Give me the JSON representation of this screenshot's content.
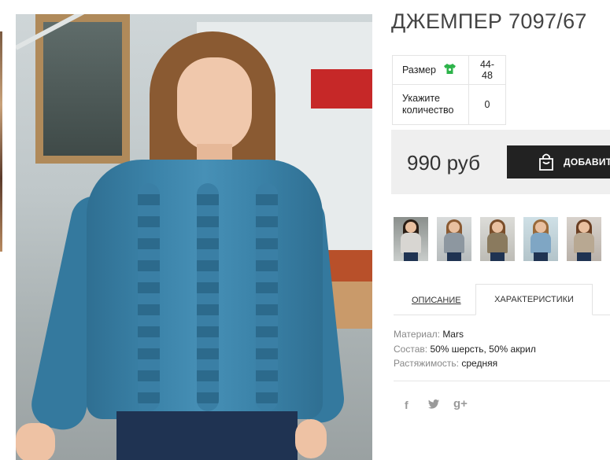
{
  "product": {
    "title": "ДЖЕМПЕР 7097/67",
    "size_label": "Размер",
    "size_value": "44-48",
    "quantity_label": "Укажите количество",
    "quantity_value": "0",
    "price": "990 руб",
    "add_button_label": "ДОБАВИТЬ"
  },
  "icons": {
    "size_icon": "tshirt-icon",
    "size_icon_color": "#2db34a",
    "cart_icon": "shopping-bag-icon",
    "social": [
      "facebook-icon",
      "twitter-icon",
      "google-plus-icon"
    ]
  },
  "social_labels": {
    "facebook": "f",
    "twitter": "🐦",
    "google_plus": "g+"
  },
  "thumbnails": [
    {
      "sweater_color": "#d8d6d2"
    },
    {
      "sweater_color": "#8d97a0"
    },
    {
      "sweater_color": "#8a7a5e"
    },
    {
      "sweater_color": "#7fa6c4"
    },
    {
      "sweater_color": "#b8a892"
    }
  ],
  "tabs": {
    "description": "ОПИСАНИЕ",
    "characteristics": "ХАРАКТЕРИСТИКИ",
    "active": "characteristics"
  },
  "specs": [
    {
      "name": "Материал:",
      "value": "Mars"
    },
    {
      "name": "Состав:",
      "value": "50% шерсть, 50% акрил"
    },
    {
      "name": "Растяжимость:",
      "value": "средняя"
    }
  ],
  "colors": {
    "button_bg": "#222222",
    "price_box_bg": "#efefef",
    "sweater_main": "#3c84aa"
  }
}
